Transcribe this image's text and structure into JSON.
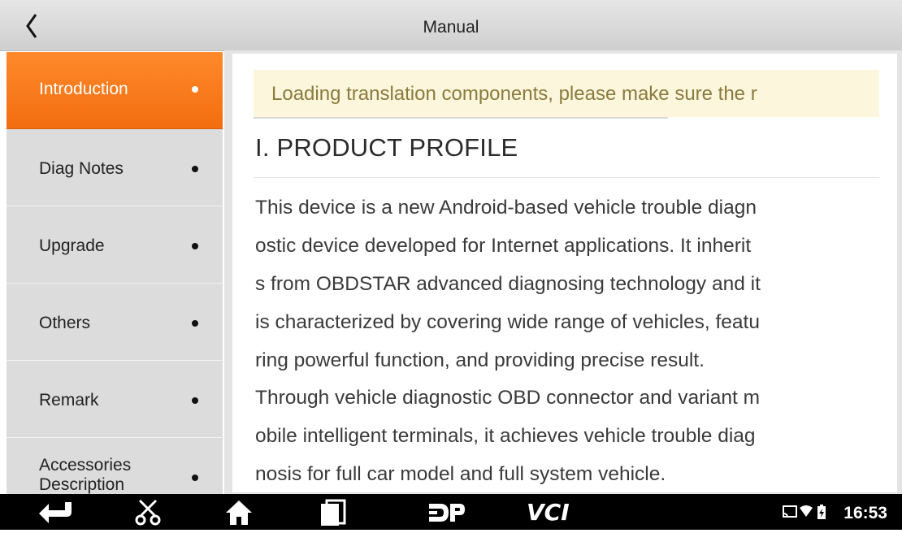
{
  "header": {
    "title": "Manual",
    "back_icon": "chevron-left-icon"
  },
  "sidebar": {
    "items": [
      {
        "label": "Introduction",
        "active": true
      },
      {
        "label": "Diag Notes",
        "active": false
      },
      {
        "label": "Upgrade",
        "active": false
      },
      {
        "label": "Others",
        "active": false
      },
      {
        "label": "Remark",
        "active": false
      },
      {
        "label": "Accessories Description",
        "active": false
      }
    ]
  },
  "content": {
    "banner": "Loading translation components, please make sure the r",
    "heading": "I. PRODUCT PROFILE",
    "para1_lines": [
      "This device is a new Android-based vehicle trouble diagn",
      "ostic device developed for Internet applications. It inherit",
      "s from OBDSTAR advanced diagnosing technology and it",
      "is characterized by covering wide range of vehicles, featu",
      "ring powerful function, and providing precise result."
    ],
    "para2_lines": [
      "Through vehicle diagnostic OBD connector and variant m",
      "obile intelligent terminals, it achieves vehicle trouble diag",
      "nosis for full car model and full system vehicle."
    ]
  },
  "navbar": {
    "icons": [
      "back-arrow-icon",
      "scissors-icon",
      "home-icon",
      "recent-apps-icon",
      "dp-logo-icon",
      "vci-logo-icon"
    ],
    "time": "16:53",
    "status_icons": [
      "cast-icon",
      "wifi-icon",
      "battery-charging-icon"
    ]
  },
  "colors": {
    "accent": "#f27312",
    "banner_bg": "#fbf6dc",
    "banner_text": "#8c7a3d",
    "sidebar_bg": "#dcdcdc"
  }
}
